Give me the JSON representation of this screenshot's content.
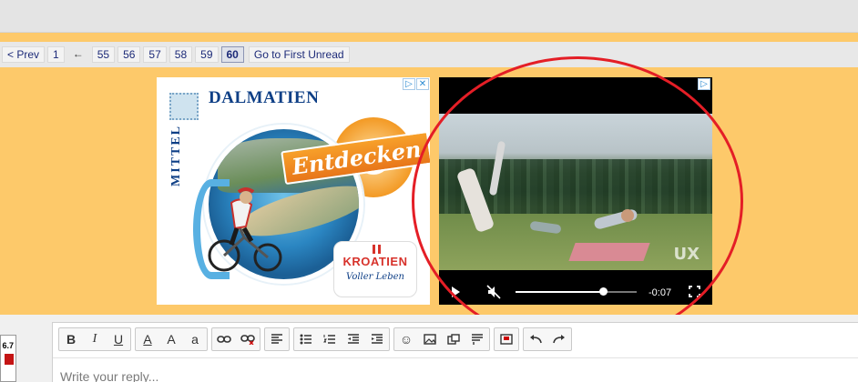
{
  "pagination": {
    "prev_label": "< Prev",
    "arrow": "←",
    "pages": [
      "1",
      "55",
      "56",
      "57",
      "58",
      "59",
      "60"
    ],
    "current_page": "60",
    "first_unread_label": "Go to First Unread"
  },
  "ad_left": {
    "title": "DALMATIEN",
    "side_text": "MITTEL",
    "cta": "Entdecken",
    "brand": "KROATIEN",
    "tagline": "Voller Leben",
    "badge": "▷✕"
  },
  "ad_video": {
    "badge": "▷",
    "watermark": "UX",
    "time_remaining": "-0:07",
    "progress_fraction": 0.72
  },
  "avatar": {
    "value": "6.7"
  },
  "editor": {
    "placeholder": "Write your reply...",
    "toolbar": {
      "bold": "B",
      "italic": "I",
      "underline": "U",
      "font_color": "A",
      "font_size": "A",
      "font_style": "a"
    }
  },
  "colors": {
    "page_background": "#fdc96a",
    "annotation_circle": "#e41e26",
    "link_blue": "#1c2a78"
  }
}
